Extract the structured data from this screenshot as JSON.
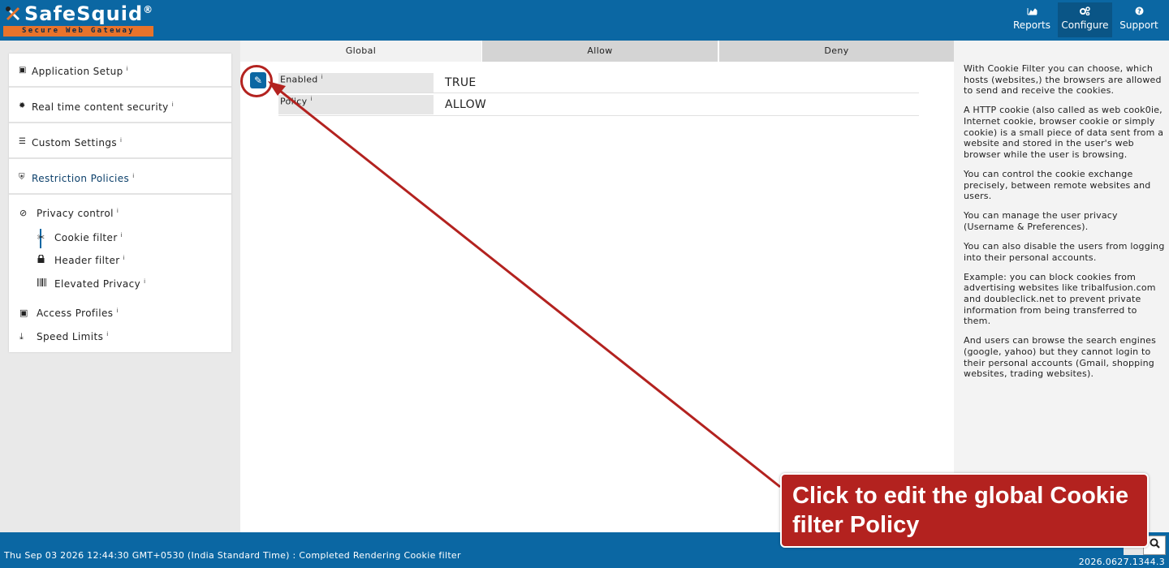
{
  "header": {
    "logo_name": "SafeSquid",
    "logo_reg": "®",
    "logo_tagline": "Secure Web Gateway",
    "nav": [
      {
        "label": "Reports",
        "icon": "chart-icon"
      },
      {
        "label": "Configure",
        "icon": "gears-icon"
      },
      {
        "label": "Support",
        "icon": "question-icon"
      }
    ]
  },
  "sidebar": {
    "sections": [
      {
        "label": "Application Setup",
        "icon": "briefcase-icon"
      },
      {
        "label": "Real time content security",
        "icon": "bug-icon"
      },
      {
        "label": "Custom Settings",
        "icon": "sliders-icon"
      },
      {
        "label": "Restriction Policies",
        "icon": "shield-icon"
      }
    ],
    "items": [
      {
        "label": "Privacy control",
        "icon": "ban-icon"
      },
      {
        "label": "Cookie filter",
        "icon": "scissors-icon"
      },
      {
        "label": "Header filter",
        "icon": "lock-icon"
      },
      {
        "label": "Elevated Privacy",
        "icon": "barcode-icon"
      },
      {
        "label": "Access Profiles",
        "icon": "briefcase-icon"
      },
      {
        "label": "Speed Limits",
        "icon": "download-icon"
      }
    ],
    "info_glyph": "i"
  },
  "tabs": [
    {
      "label": "Global"
    },
    {
      "label": "Allow"
    },
    {
      "label": "Deny"
    }
  ],
  "policy": {
    "rows": [
      {
        "label": "Enabled",
        "value": "TRUE"
      },
      {
        "label": "Policy",
        "value": "ALLOW"
      }
    ]
  },
  "help": {
    "paragraphs": [
      "With Cookie Filter you can choose, which hosts (websites,) the browsers are allowed to send and receive the cookies.",
      "A HTTP cookie (also called as web cook0ie, Internet cookie, browser cookie or simply cookie) is a small piece of data sent from a website and stored in the user's web browser while the user is browsing.",
      "You can control the cookie exchange precisely, between remote websites and users.",
      "You can manage the user privacy (Username & Preferences).",
      "You can also disable the users from logging into their personal accounts.",
      "Example: you can block cookies from advertising websites like tribalfusion.com and doubleclick.net to prevent private information from being transferred to them.",
      "And users can browse the search engines (google, yahoo) but they cannot login to their personal accounts (Gmail, shopping websites, trading websites)."
    ]
  },
  "footer": {
    "status": "Thu Sep 03 2026 12:44:30 GMT+0530 (India Standard Time) : Completed Rendering Cookie filter",
    "version": "2026.0627.1344.3"
  },
  "callout": {
    "text": "Click to edit the global Cookie filter Policy"
  },
  "colors": {
    "brand": "#0b67a3",
    "accent_orange": "#e8732b",
    "callout_red": "#b3221f"
  }
}
